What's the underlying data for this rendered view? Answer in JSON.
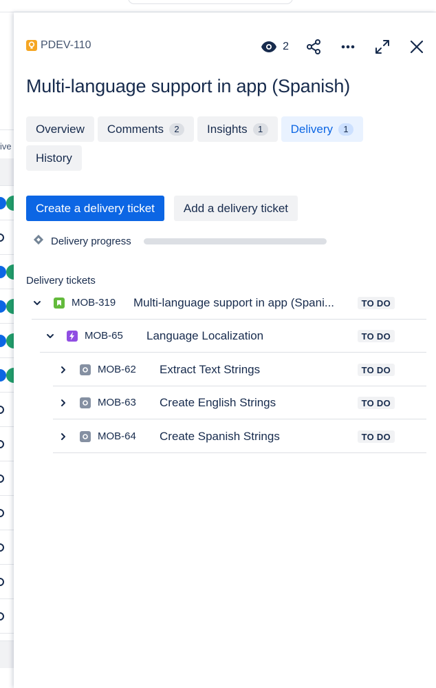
{
  "issue": {
    "key": "PDEV-110",
    "title": "Multi-language support in app (Spanish)",
    "watchers": "2"
  },
  "background": {
    "column_header_fragment": "ive"
  },
  "tabs": [
    {
      "label": "Overview",
      "count": ""
    },
    {
      "label": "Comments",
      "count": "2"
    },
    {
      "label": "Insights",
      "count": "1"
    },
    {
      "label": "Delivery",
      "count": "1",
      "active": true
    },
    {
      "label": "History",
      "count": ""
    }
  ],
  "delivery": {
    "create_button": "Create a delivery ticket",
    "add_button": "Add a delivery ticket",
    "progress_label": "Delivery progress",
    "progress_fraction": 0,
    "tickets_label": "Delivery tickets",
    "tickets": [
      {
        "key": "MOB-319",
        "summary": "Multi-language support in app (Spani...",
        "status": "TO DO",
        "type": "story",
        "expanded": true
      },
      {
        "key": "MOB-65",
        "summary": "Language Localization",
        "status": "TO DO",
        "type": "epic",
        "expanded": true
      },
      {
        "key": "MOB-62",
        "summary": "Extract Text Strings",
        "status": "TO DO",
        "type": "task",
        "expanded": false
      },
      {
        "key": "MOB-63",
        "summary": "Create English Strings",
        "status": "TO DO",
        "type": "task",
        "expanded": false
      },
      {
        "key": "MOB-64",
        "summary": "Create Spanish Strings",
        "status": "TO DO",
        "type": "task",
        "expanded": false
      }
    ]
  },
  "colors": {
    "primary": "#0c66e4",
    "idea": "#f5a623",
    "story": "#63ba3c",
    "epic": "#904ee2",
    "task": "#8590a2"
  }
}
